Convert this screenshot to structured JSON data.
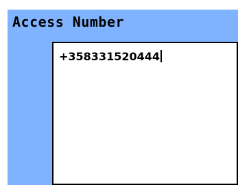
{
  "dialog": {
    "title": "Access Number"
  },
  "access_number_field": {
    "value": "+358331520444"
  },
  "colors": {
    "panel_background": "#7fb3ff",
    "field_background": "#ffffff",
    "text": "#000000"
  }
}
